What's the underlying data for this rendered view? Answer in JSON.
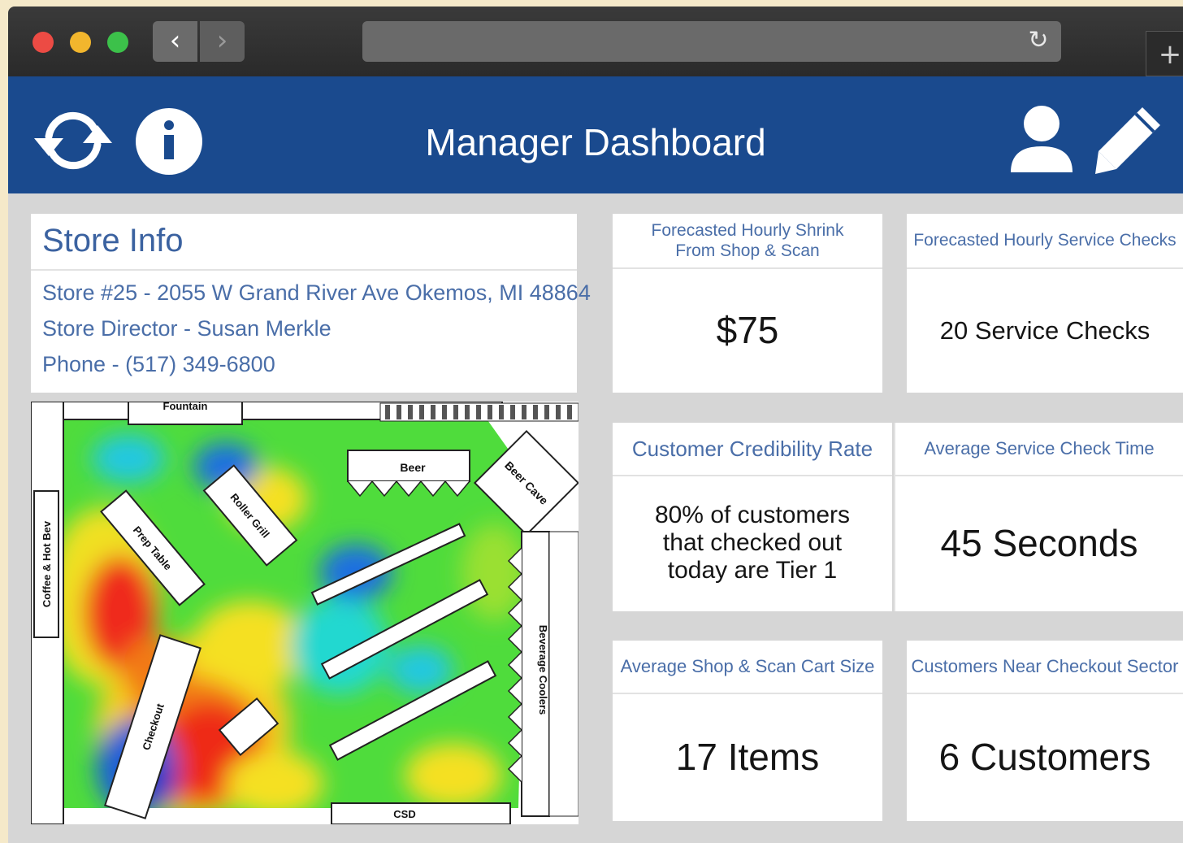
{
  "browser": {
    "back_icon": "chevron-left-icon",
    "forward_icon": "chevron-right-icon",
    "reload_icon": "reload-icon",
    "newtab_icon": "plus-icon"
  },
  "header": {
    "title": "Manager Dashboard",
    "left_icons": [
      "refresh-icon",
      "info-icon"
    ],
    "right_icons": [
      "user-icon",
      "pencil-icon"
    ],
    "background": "#1a4a8e"
  },
  "store_info": {
    "title": "Store Info",
    "address": "Store #25 - 2055 W Grand River Ave Okemos, MI 48864",
    "director": "Store Director - Susan Merkle",
    "phone": "Phone - (517) 349-6800"
  },
  "map": {
    "labels": {
      "fountain": "Fountain",
      "beer": "Beer",
      "beer_cave": "Beer Cave",
      "roller_grill": "Roller Grill",
      "prep_table": "Prep Table",
      "coffee": "Coffee & Hot Bev",
      "checkout": "Checkout",
      "beverage_coolers": "Beverage Coolers",
      "csd": "CSD"
    }
  },
  "metrics": {
    "shrink": {
      "label": "Forecasted Hourly Shrink From Shop & Scan",
      "value": "$75"
    },
    "service_checks": {
      "label": "Forecasted Hourly Service Checks",
      "value": "20 Service Checks"
    },
    "credibility": {
      "label": "Customer Credibility Rate",
      "value": "80% of customers that checked out today are Tier 1"
    },
    "check_time": {
      "label": "Average Service Check Time",
      "value": "45 Seconds"
    },
    "cart_size": {
      "label": "Average Shop & Scan Cart Size",
      "value": "17 Items"
    },
    "near_checkout": {
      "label": "Customers Near Checkout Sector",
      "value": "6 Customers"
    }
  },
  "colors": {
    "accent": "#1a4a8e",
    "label_text": "#4a6ea8",
    "canvas": "#d6d6d6"
  }
}
